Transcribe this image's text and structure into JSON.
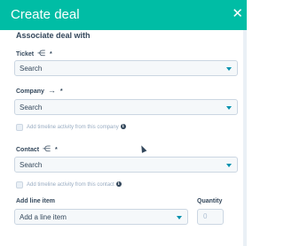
{
  "dialog": {
    "title": "Create deal",
    "close_icon": "close-icon"
  },
  "associate": {
    "title": "Associate deal with"
  },
  "ticket": {
    "label": "Ticket",
    "icon": "merge-icon",
    "required": "*",
    "value": "Search"
  },
  "company": {
    "label": "Company",
    "icon": "arrow-right-icon",
    "required": "*",
    "value": "Search",
    "timeline_label": "Add timeline activity from this company"
  },
  "contact": {
    "label": "Contact",
    "icon": "merge-icon",
    "required": "*",
    "value": "Search",
    "timeline_label": "Add timeline activity from this contact"
  },
  "line_item": {
    "label": "Add line item",
    "value": "Add a line item"
  },
  "quantity": {
    "label": "Quantity",
    "value": "0"
  },
  "colors": {
    "header": "#00bda5",
    "accent": "#0091ae",
    "text": "#33475b"
  }
}
